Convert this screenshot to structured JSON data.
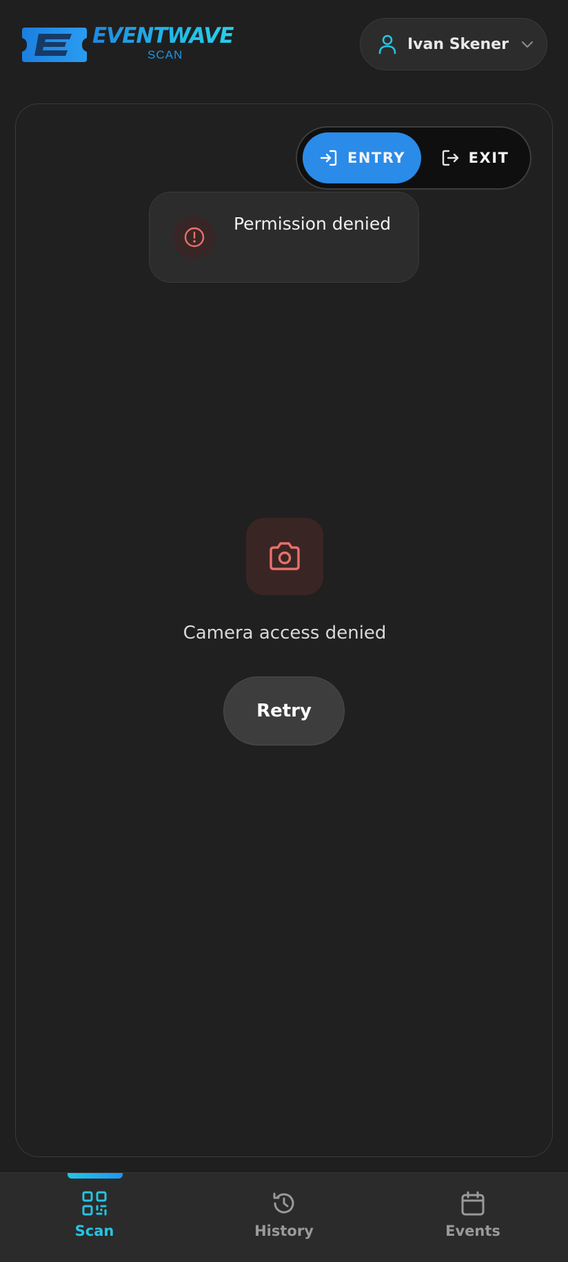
{
  "header": {
    "logo": {
      "word": "EVENTWAVE",
      "sub": "SCAN"
    },
    "user": {
      "name": "Ivan Skener",
      "icon": "user-icon",
      "chevron": "chevron-down-icon"
    }
  },
  "mode_toggle": {
    "entry": {
      "label": "ENTRY",
      "icon": "login-arrow-icon",
      "selected": true
    },
    "exit": {
      "label": "EXIT",
      "icon": "logout-arrow-icon",
      "selected": false
    }
  },
  "toast": {
    "message": "Permission denied",
    "icon": "alert-circle-icon"
  },
  "camera_state": {
    "icon": "camera-icon",
    "message": "Camera access denied",
    "retry_label": "Retry"
  },
  "nav": {
    "items": [
      {
        "label": "Scan",
        "icon": "qr-code-icon",
        "active": true
      },
      {
        "label": "History",
        "icon": "history-icon",
        "active": false
      },
      {
        "label": "Events",
        "icon": "calendar-icon",
        "active": false
      }
    ]
  },
  "colors": {
    "background": "#1f1f1f",
    "accent_blue": "#2b8be8",
    "accent_cyan": "#25c4e3",
    "error_red": "#e8726a",
    "inactive_gray": "#9a9a9a"
  }
}
